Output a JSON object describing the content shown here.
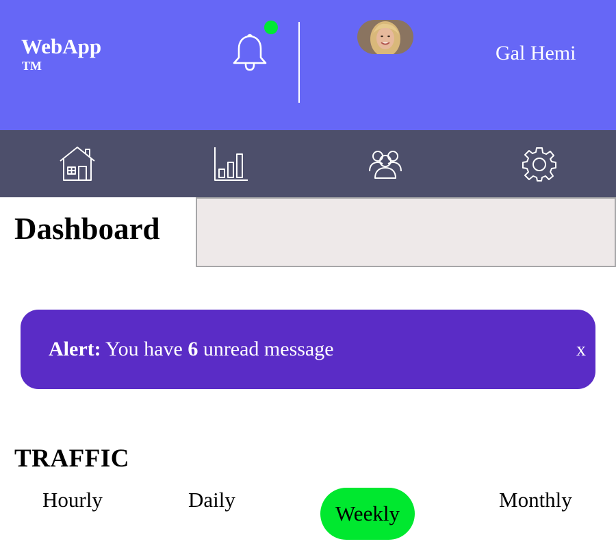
{
  "header": {
    "brand": "WebApp",
    "trademark": "TM",
    "icons": {
      "notifications": "bell-icon"
    },
    "has_notification": true,
    "user": {
      "name": "Gal Hemi",
      "avatar": "user-avatar"
    }
  },
  "nav": {
    "items": [
      {
        "name": "home",
        "icon": "house-icon"
      },
      {
        "name": "statistics",
        "icon": "bar-chart-icon"
      },
      {
        "name": "members",
        "icon": "users-icon"
      },
      {
        "name": "settings",
        "icon": "gear-icon"
      }
    ]
  },
  "main": {
    "title": "Dashboard",
    "search": {
      "value": "",
      "placeholder": ""
    }
  },
  "alert": {
    "label": "Alert:",
    "text_before": "You have",
    "count": "6",
    "text_after": "unread message",
    "close": "x"
  },
  "traffic": {
    "title": "TRAFFIC",
    "tabs": [
      "Hourly",
      "Daily",
      "Weekly",
      "Monthly"
    ],
    "selected": "Weekly"
  },
  "colors": {
    "header_bg": "#6667f6",
    "nav_bg": "#4d4f6b",
    "alert_bg": "#5a2cc6",
    "accent_green": "#00e834",
    "search_bg": "#eee9e9"
  }
}
